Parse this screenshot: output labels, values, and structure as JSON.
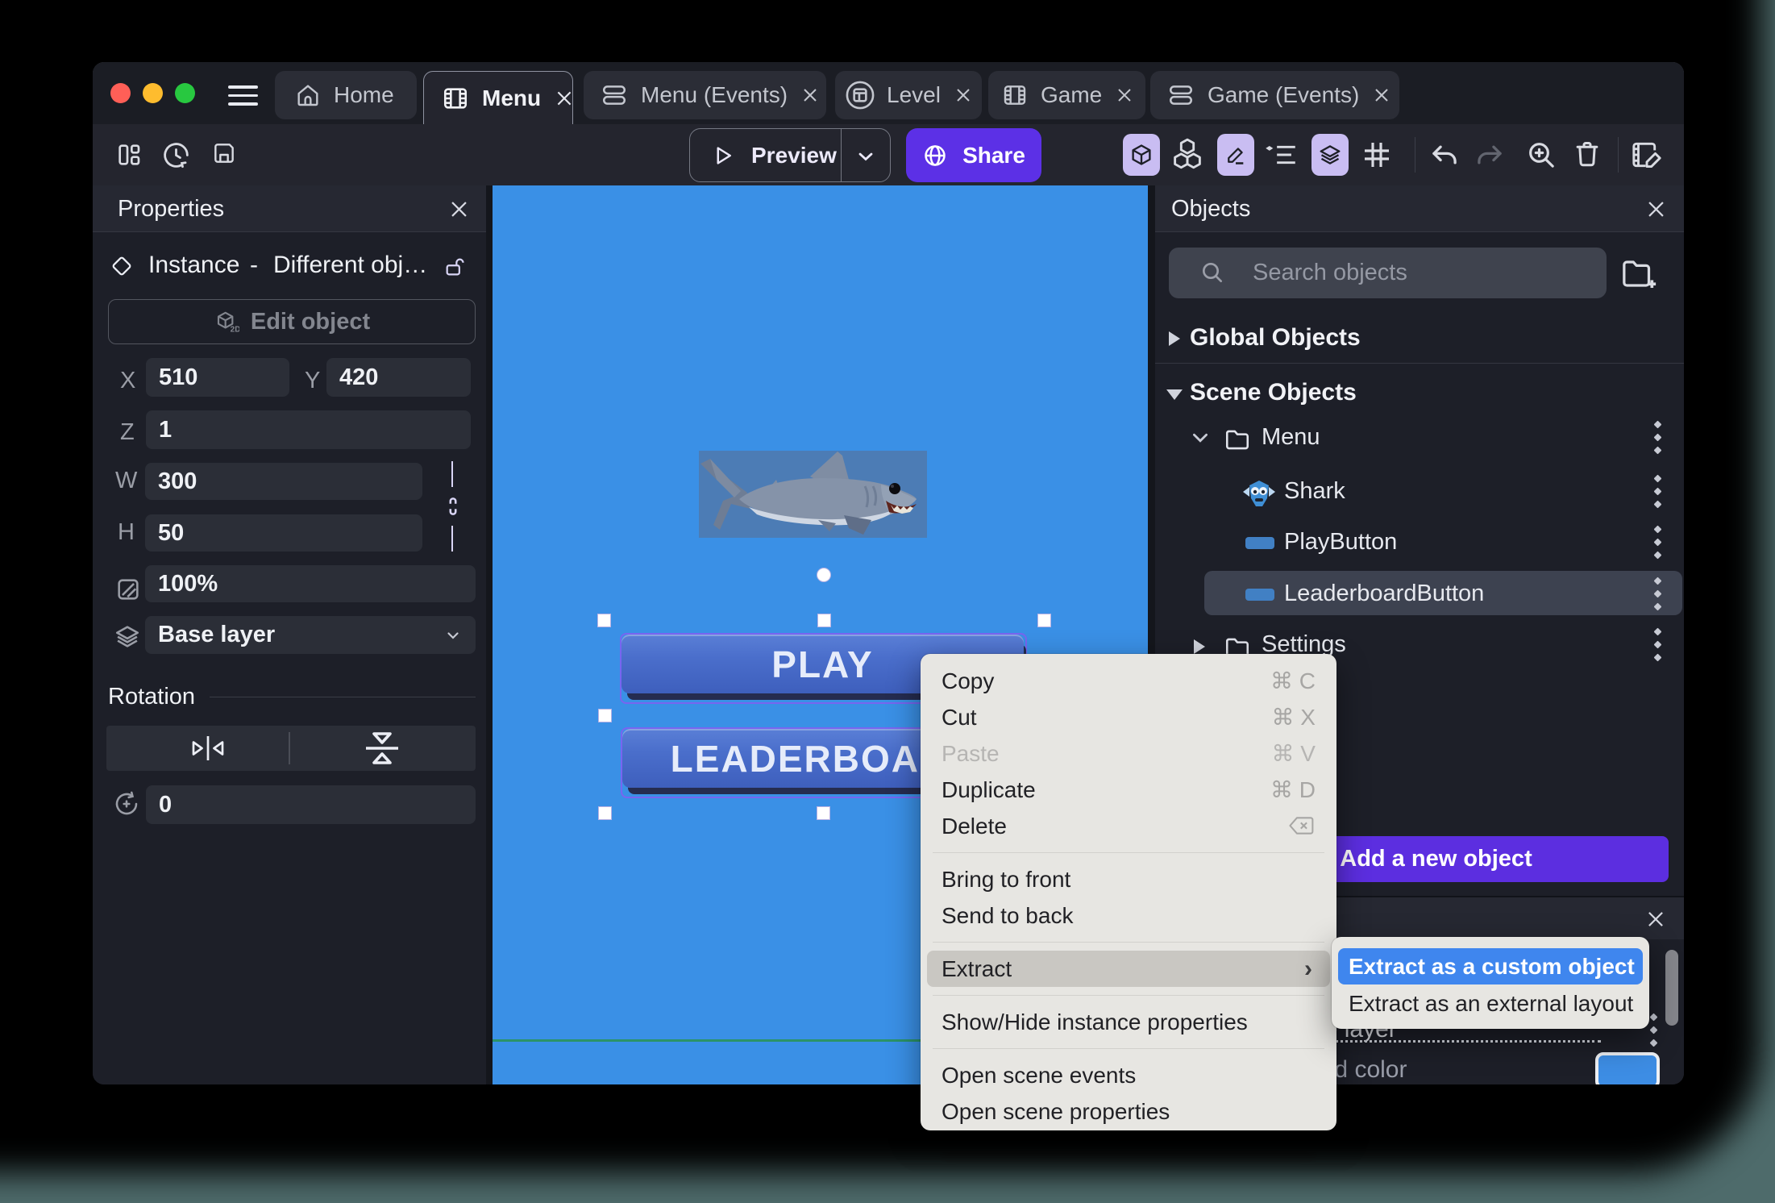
{
  "window_controls": {
    "close_color": "#ff5f57",
    "minimize_color": "#febc2e",
    "zoom_color": "#28c840"
  },
  "tabs": [
    {
      "label": "Home",
      "icon": "home"
    },
    {
      "label": "Menu",
      "icon": "film",
      "active": true,
      "closable": true
    },
    {
      "label": "Menu (Events)",
      "icon": "events",
      "closable": true
    },
    {
      "label": "Level",
      "icon": "level",
      "closable": true
    },
    {
      "label": "Game",
      "icon": "film",
      "closable": true
    },
    {
      "label": "Game (Events)",
      "icon": "events",
      "closable": true
    }
  ],
  "toolbar": {
    "preview_label": "Preview",
    "share_label": "Share",
    "left_icons": [
      "layout-dashboard",
      "history-clock",
      "save"
    ],
    "right_icons": [
      "cube-3d",
      "blocks",
      "pencil",
      "instances-list",
      "layers",
      "grid",
      "undo",
      "redo",
      "zoom-in",
      "trash",
      "edit-scene"
    ]
  },
  "properties_panel": {
    "title": "Properties",
    "instance_label": "Instance",
    "separator": "-",
    "object_name": "Different obj…",
    "edit_object_label": "Edit object",
    "x_label": "X",
    "x_value": "510",
    "y_label": "Y",
    "y_value": "420",
    "z_label": "Z",
    "z_value": "1",
    "w_label": "W",
    "w_value": "300",
    "h_label": "H",
    "h_value": "50",
    "opacity_value": "100%",
    "layer_value": "Base layer",
    "rotation_title": "Rotation",
    "rotation_value": "0"
  },
  "canvas": {
    "background_color": "#3a90e6",
    "play_button_label": "PLAY",
    "leaderboard_button_label": "LEADERBOARD",
    "selected_instance": "LeaderboardButton"
  },
  "objects_panel": {
    "title": "Objects",
    "search_placeholder": "Search objects",
    "global_objects_label": "Global Objects",
    "scene_objects_label": "Scene Objects",
    "folder1_label": "Menu",
    "item1_label": "Shark",
    "item2_label": "PlayButton",
    "item3_label": "LeaderboardButton",
    "folder2_label": "Settings",
    "add_button_label": "Add a new object"
  },
  "layers_panel": {
    "base_layer_label": "Base layer",
    "background_color_label": "Background color",
    "swatch_color": "#3d8de4"
  },
  "context_menu": {
    "copy": "Copy",
    "copy_shortcut": "⌘ C",
    "cut": "Cut",
    "cut_shortcut": "⌘ X",
    "paste": "Paste",
    "paste_shortcut": "⌘ V",
    "duplicate": "Duplicate",
    "duplicate_shortcut": "⌘ D",
    "delete": "Delete",
    "bring_to_front": "Bring to front",
    "send_to_back": "Send to back",
    "extract": "Extract",
    "show_hide": "Show/Hide instance properties",
    "open_scene_events": "Open scene events",
    "open_scene_properties": "Open scene properties"
  },
  "submenu": {
    "item1": "Extract as a custom object",
    "item2": "Extract as an external layout"
  }
}
